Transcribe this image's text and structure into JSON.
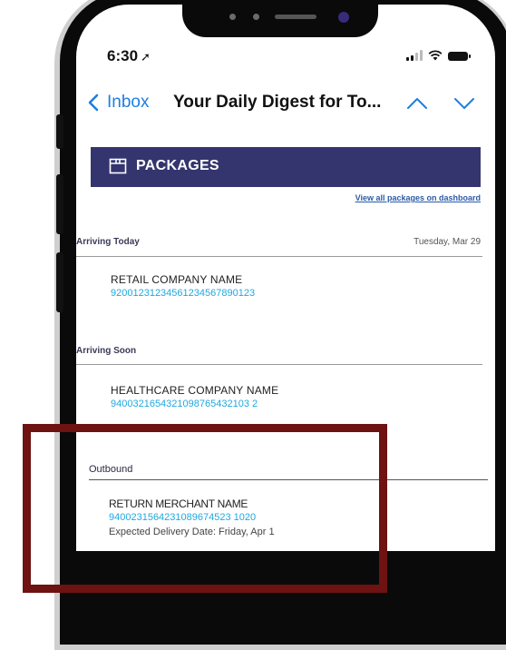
{
  "status_bar": {
    "time": "6:30",
    "location_arrow": "➚"
  },
  "nav": {
    "back_label": "Inbox",
    "title": "Your Daily Digest for To...",
    "icons": [
      "chevron-left-icon",
      "chevron-up-icon",
      "chevron-down-icon"
    ]
  },
  "banner": {
    "label": "PACKAGES",
    "icon": "package-icon",
    "color": "#34356e"
  },
  "view_all_link": "View all packages on dashboard",
  "sections": [
    {
      "label": "Arriving Today",
      "date": "Tuesday, Mar 29",
      "packages": [
        {
          "name": "RETAIL COMPANY NAME",
          "tracking": "92001231234561234567890123"
        }
      ]
    },
    {
      "label": "Arriving Soon",
      "date": "",
      "packages": [
        {
          "name": "HEALTHCARE COMPANY NAME",
          "tracking": "9400321654321098765432103 2"
        }
      ]
    },
    {
      "label": "Outbound",
      "date": "",
      "packages": [
        {
          "name": "RETURN MERCHANT NAME",
          "tracking": "9400231564231089674523 1020",
          "expected": "Expected Delivery Date: Friday, Apr 1"
        }
      ]
    }
  ],
  "colors": {
    "link_blue": "#1e7fe0",
    "tracking_cyan": "#1fa8e0",
    "highlight_border": "#6e1212"
  }
}
